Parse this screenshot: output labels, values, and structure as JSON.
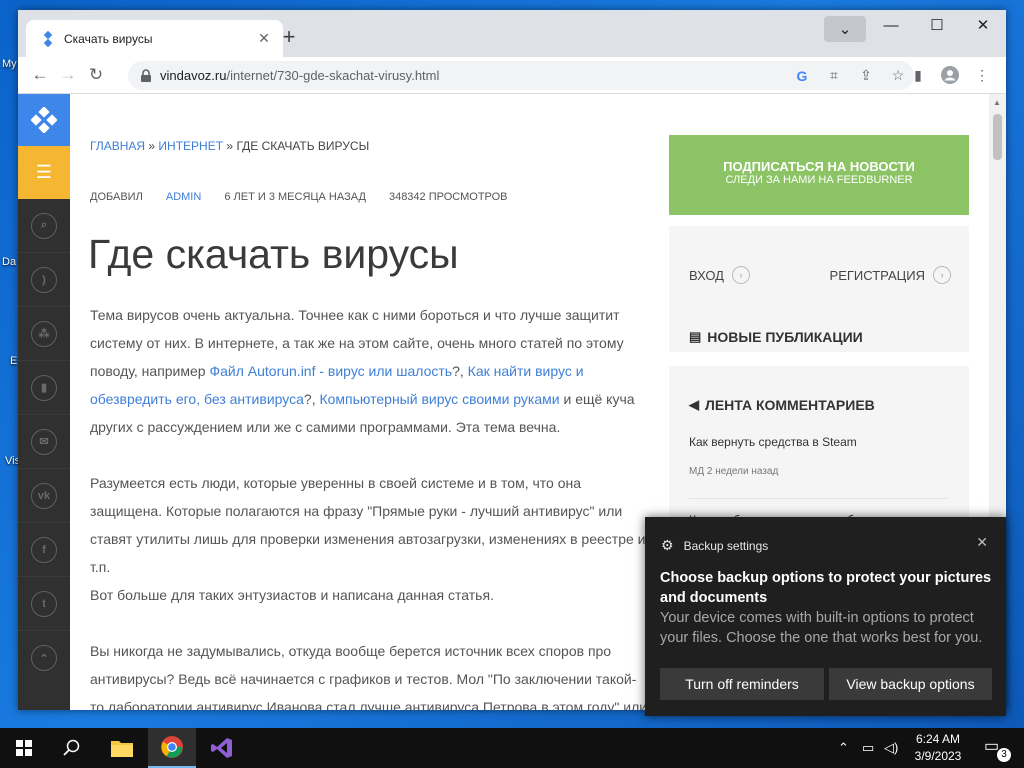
{
  "desktop": {
    "labels": [
      "My",
      "Da",
      "E",
      "Vis"
    ]
  },
  "browser": {
    "tab": {
      "title": "Скачать вирусы"
    },
    "address": {
      "domain": "vindavoz.ru",
      "path": "/internet/730-gde-skachat-virusy.html"
    },
    "icons": {
      "back": "back-arrow-icon",
      "forward": "forward-arrow-icon",
      "reload": "reload-icon"
    }
  },
  "page": {
    "breadcrumb": {
      "home": "ГЛАВНАЯ",
      "sep1": "»",
      "section": "ИНТЕРНЕТ",
      "sep2": "»",
      "current": "ГДЕ СКАЧАТЬ ВИРУСЫ"
    },
    "meta": {
      "added_by_label": "ДОБАВИЛ",
      "author": "ADMIN",
      "age": "6 ЛЕТ И 3 МЕСЯЦА НАЗАД",
      "views": "348342 ПРОСМОТРОВ"
    },
    "title": "Где скачать вирусы",
    "paragraphs": {
      "p1_a": "Тема вирусов очень актуальна. Точнее как с ними бороться и что лучше защитит систему от них. В интернете, а так же на этом сайте, очень много статей по этому поводу, например ",
      "p1_link1": "Файл Autorun.inf - вирус или шалость",
      "p1_b": "?, ",
      "p1_link2": "Как найти вирус и обезвредить его, без антивируса",
      "p1_c": "?, ",
      "p1_link3": "Компьютерный вирус своими руками",
      "p1_d": " и ещё куча других с рассуждением или же с самими программами. Эта тема вечна.",
      "p2": "Разумеется есть люди, которые уверенны в своей системе и в том, что она защищена. Которые полагаются на фразу \"Прямые руки - лучший антивирус\" или ставят утилиты лишь для проверки изменения автозагрузки, изменениях в реестре и т.п.",
      "p2b": "Вот больше для таких энтузиастов и написана данная статья.",
      "p3": "Вы никогда не задумывались, откуда вообще берется источник всех споров про антивирусы? Ведь всё начинается с графиков и тестов. Мол \"По заключении такой-то лаборатории антивирус Иванова стал лучше антивируса Петрова в этом году\" или"
    },
    "sidebar_right": {
      "subscribe_title": "ПОДПИСАТЬСЯ НА НОВОСТИ",
      "subscribe_sub": "СЛЕДИ ЗА НАМИ НА FEEDBURNER",
      "login": "ВХОД",
      "register": "РЕГИСТРАЦИЯ",
      "new_posts": "НОВЫЕ ПУБЛИКАЦИИ",
      "comments_feed": "ЛЕНТА КОММЕНТАРИЕВ",
      "comments": [
        {
          "title": "Как вернуть средства в Steam",
          "meta": "МД 2 недели назад"
        },
        {
          "title": "Кракозябры вместо русских букв"
        }
      ]
    }
  },
  "toast": {
    "app": "Backup settings",
    "title": "Choose backup options to protect your pictures and documents",
    "text": "Your device comes with built-in options to protect your files. Choose the one that works best for you.",
    "btn_off": "Turn off reminders",
    "btn_view": "View backup options"
  },
  "taskbar": {
    "time": "6:24 AM",
    "date": "3/9/2023",
    "notifications": "3"
  }
}
